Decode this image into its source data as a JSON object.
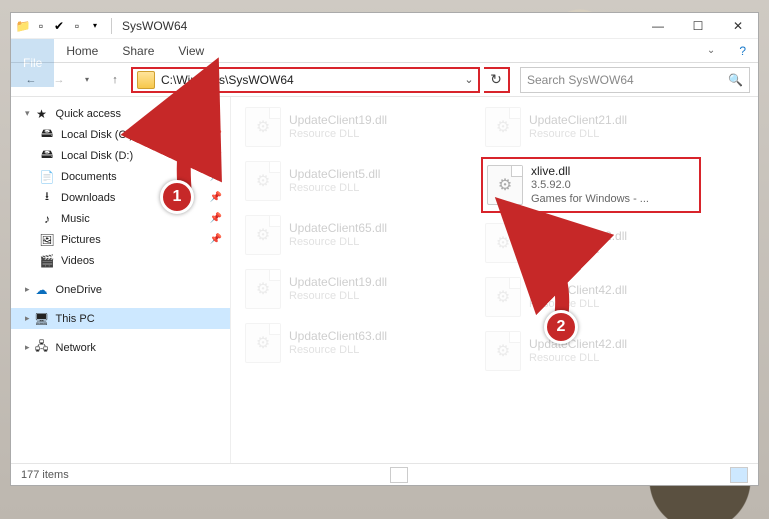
{
  "title": "SysWOW64",
  "ribbon": {
    "file": "File",
    "home": "Home",
    "share": "Share",
    "view": "View"
  },
  "address": "C:\\Windows\\SysWOW64",
  "search_placeholder": "Search SysWOW64",
  "sidebar": {
    "quick_access": "Quick access",
    "items": [
      {
        "label": "Local Disk (C:)"
      },
      {
        "label": "Local Disk (D:)"
      },
      {
        "label": "Documents"
      },
      {
        "label": "Downloads"
      },
      {
        "label": "Music"
      },
      {
        "label": "Pictures"
      },
      {
        "label": "Videos"
      }
    ],
    "onedrive": "OneDrive",
    "this_pc": "This PC",
    "network": "Network"
  },
  "files_left": [
    {
      "name": "UpdateClient19.dll",
      "sub": "Resource DLL"
    },
    {
      "name": "UpdateClient5.dll",
      "sub": "Resource DLL"
    },
    {
      "name": "UpdateClient65.dll",
      "sub": "Resource DLL"
    },
    {
      "name": "UpdateClient19.dll",
      "sub": "Resource DLL"
    },
    {
      "name": "UpdateClient63.dll",
      "sub": "Resource DLL"
    }
  ],
  "files_right": [
    {
      "name": "UpdateClient21.dll",
      "sub": "Resource DLL"
    },
    {
      "name": "xlive.dll",
      "sub1": "3.5.92.0",
      "sub2": "Games for Windows - ...",
      "hl": true
    },
    {
      "name": "UpdateClient42.dll",
      "sub": "Resource DLL"
    },
    {
      "name": "UpdateClient42.dll",
      "sub": "Resource DLL"
    },
    {
      "name": "UpdateClient42.dll",
      "sub": "Resource DLL"
    }
  ],
  "status": {
    "count": "177 items"
  },
  "annotations": {
    "step1": "1",
    "step2": "2"
  }
}
